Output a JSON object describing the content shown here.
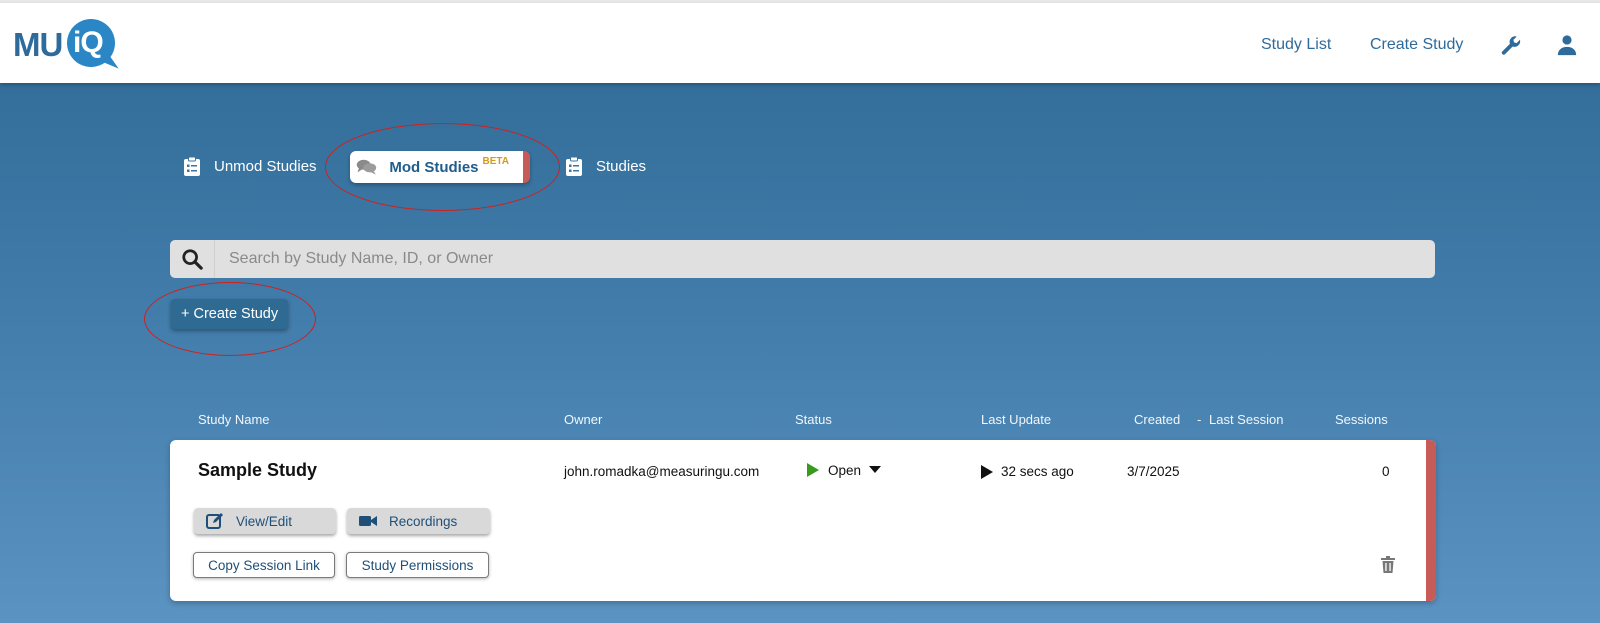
{
  "header": {
    "logo_mu": "MU",
    "logo_iq": "iQ",
    "nav": {
      "study_list": "Study List",
      "create_study": "Create Study"
    },
    "icons": [
      "wrench-icon",
      "user-icon"
    ]
  },
  "tabs": [
    {
      "label": "Unmod Studies",
      "icon": "clipboard-icon",
      "active": false
    },
    {
      "label": "Mod Studies",
      "badge": "BETA",
      "icon": "chat-bubbles-icon",
      "active": true
    },
    {
      "label": "Studies",
      "icon": "clipboard-icon",
      "active": false
    }
  ],
  "search": {
    "placeholder": "Search by Study Name, ID, or Owner",
    "value": ""
  },
  "create_button": "+ Create Study",
  "table": {
    "headers": {
      "study_name": "Study Name",
      "owner": "Owner",
      "status": "Status",
      "last_update": "Last Update",
      "created": "Created",
      "separator": "-",
      "last_session": "Last Session",
      "sessions": "Sessions"
    },
    "rows": [
      {
        "name": "Sample Study",
        "owner": "john.romadka@measuringu.com",
        "status": "Open",
        "last_update": "32 secs ago",
        "created": "3/7/2025",
        "sessions": "0",
        "actions": {
          "view_edit": "View/Edit",
          "recordings": "Recordings",
          "copy_link": "Copy Session Link",
          "permissions": "Study Permissions"
        }
      }
    ]
  },
  "colors": {
    "accent": "#2f6b9a",
    "status_open": "#3a9a1f",
    "row_marker": "#c75b57",
    "beta": "#d59a1a",
    "annotation": "#d0201d"
  }
}
